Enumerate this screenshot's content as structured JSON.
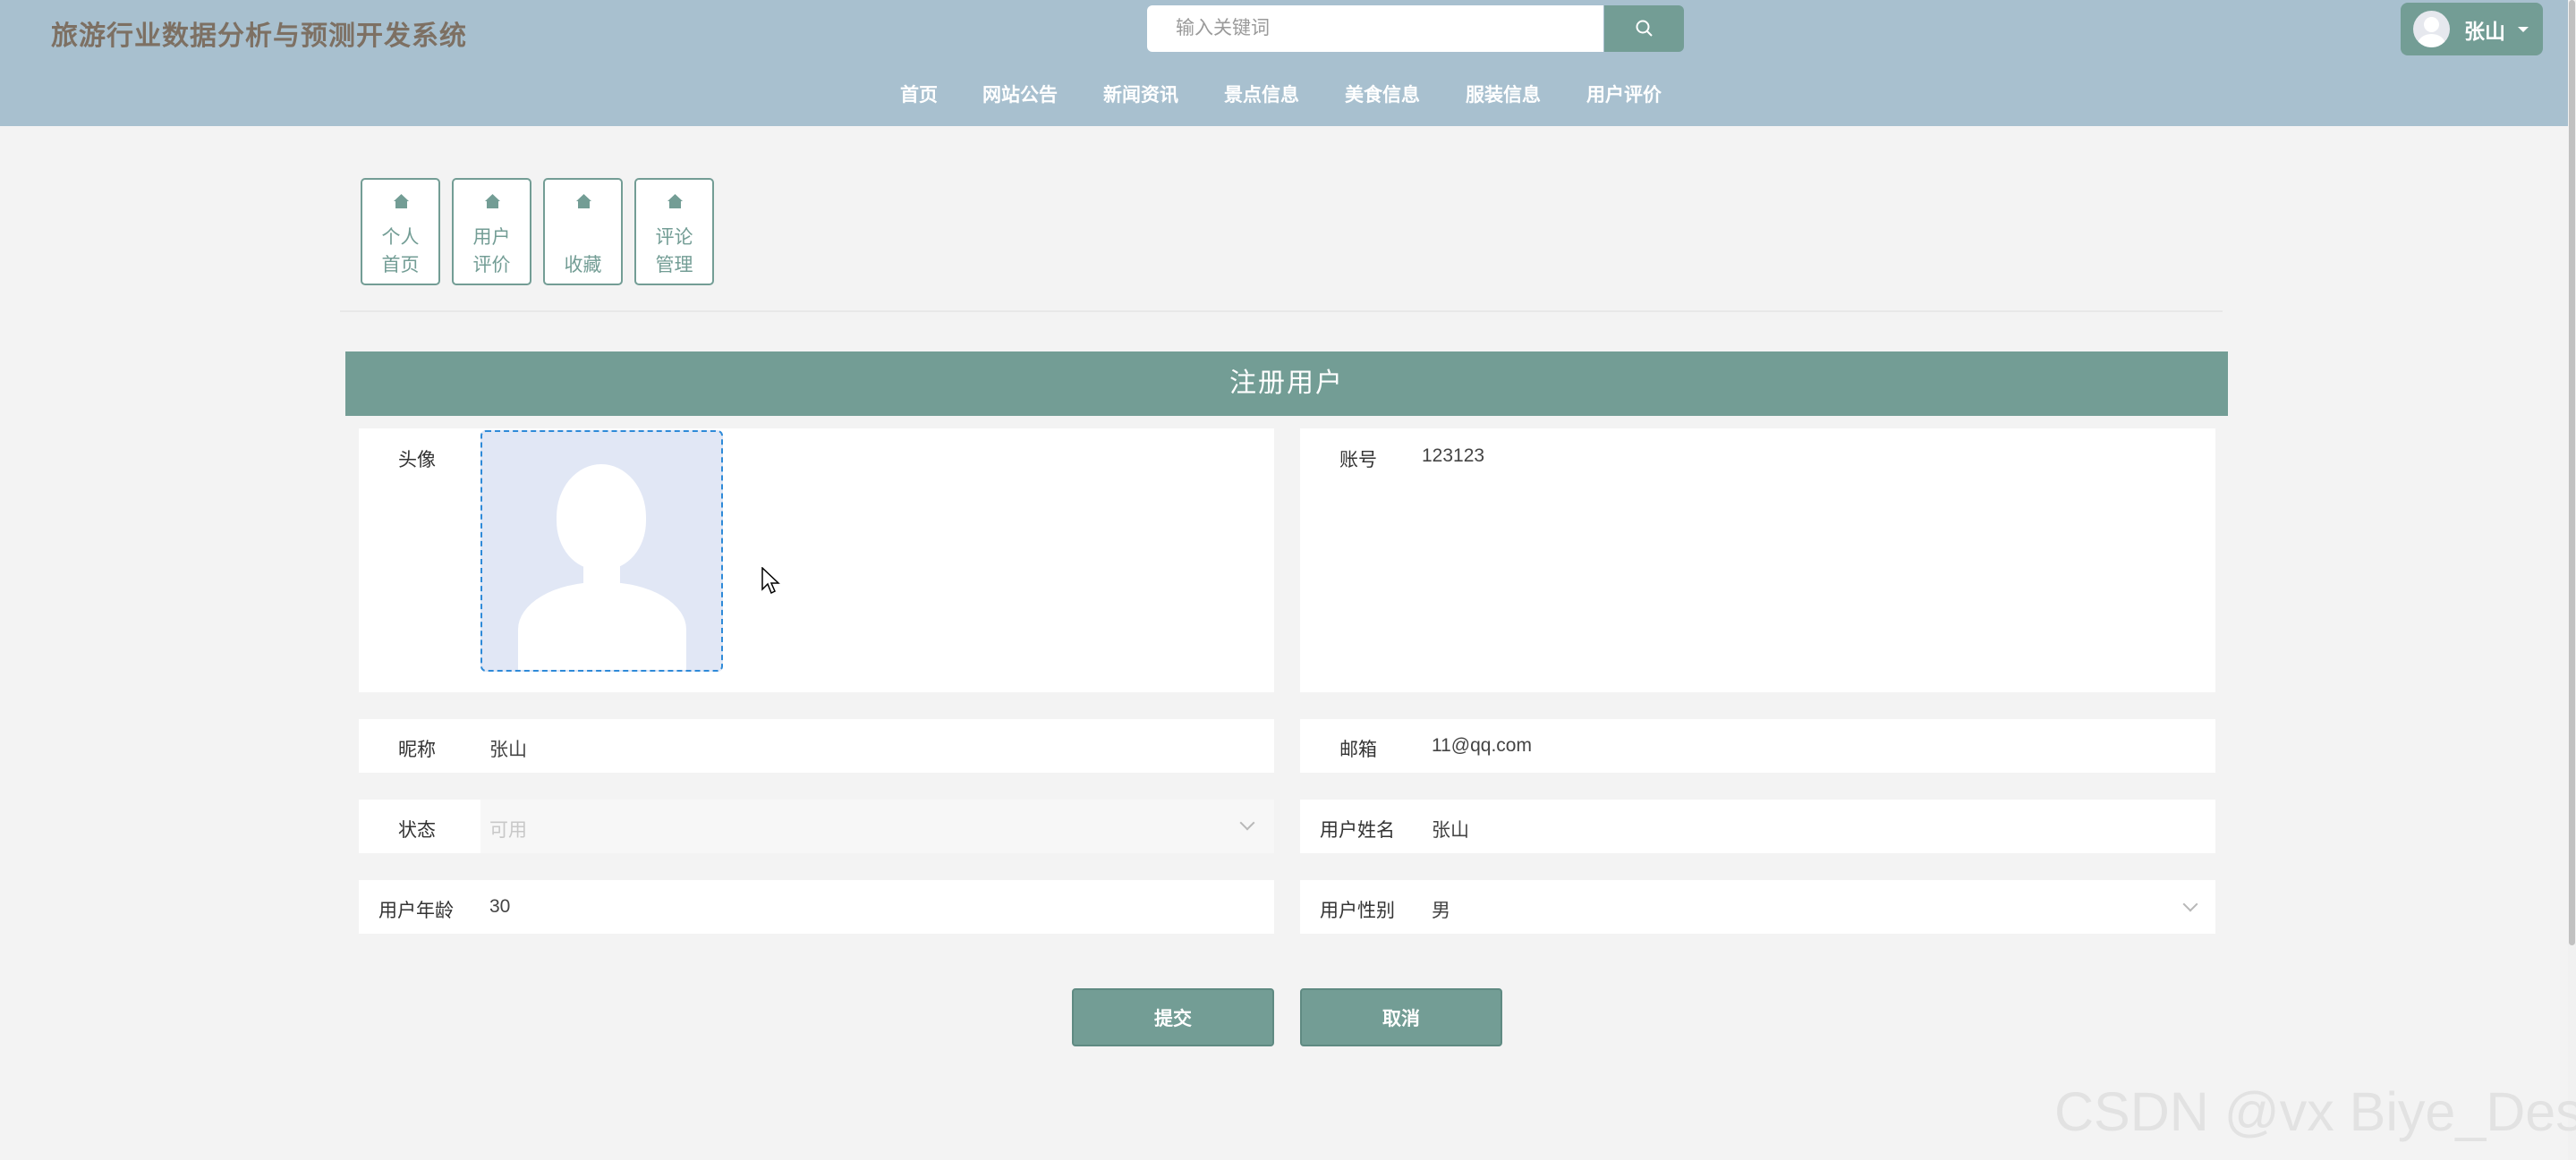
{
  "header": {
    "site_title": "旅游行业数据分析与预测开发系统",
    "search_placeholder": "输入关键词",
    "search_icon": "search-icon",
    "user_name": "张山",
    "user_menu_icon": "caret-down-icon",
    "nav": [
      "首页",
      "网站公告",
      "新闻资讯",
      "景点信息",
      "美食信息",
      "服装信息",
      "用户评价"
    ]
  },
  "tiles": [
    {
      "icon": "home-icon",
      "line1": "个人",
      "line2": "首页"
    },
    {
      "icon": "home-icon",
      "line1": "用户",
      "line2": "评价"
    },
    {
      "icon": "home-icon",
      "line1": "",
      "line2": "收藏"
    },
    {
      "icon": "home-icon",
      "line1": "评论",
      "line2": "管理"
    }
  ],
  "form": {
    "title": "注册用户",
    "avatar_label": "头像",
    "account_label": "账号",
    "account_value": "123123",
    "nickname_label": "昵称",
    "nickname_value": "张山",
    "email_label": "邮箱",
    "email_value": "11@qq.com",
    "status_label": "状态",
    "status_value": "可用",
    "realname_label": "用户姓名",
    "realname_value": "张山",
    "age_label": "用户年龄",
    "age_value": "30",
    "gender_label": "用户性别",
    "gender_value": "男",
    "submit_label": "提交",
    "cancel_label": "取消"
  },
  "watermark": "CSDN @vx Biye_Design",
  "colors": {
    "header_bg": "#a8c0cf",
    "accent": "#739d95",
    "page_bg": "#f3f3f3"
  }
}
